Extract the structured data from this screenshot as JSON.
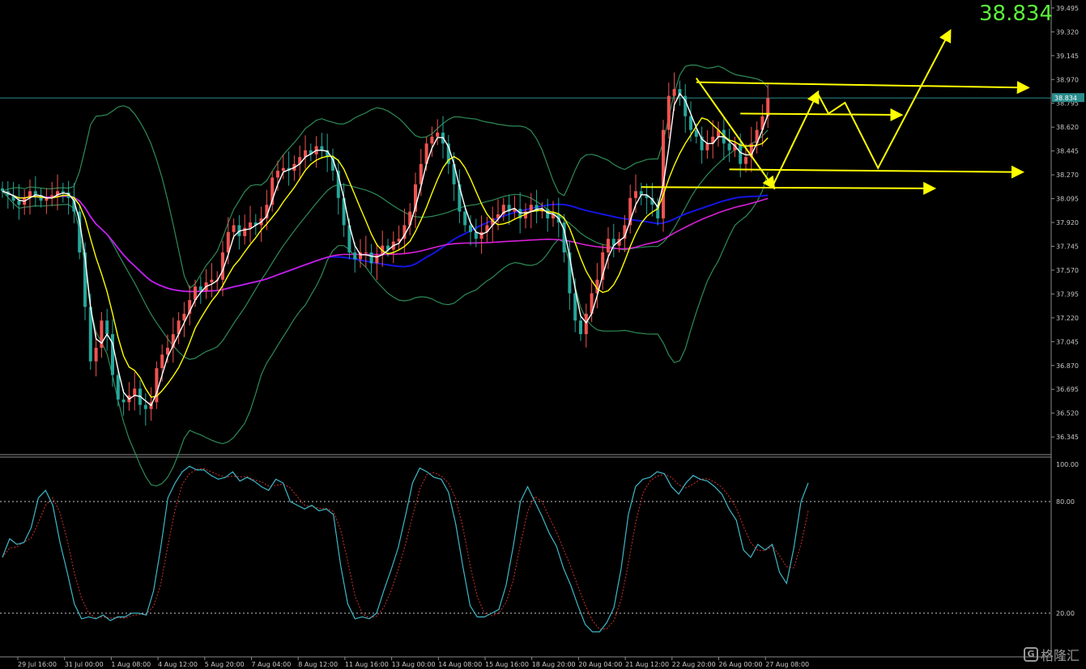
{
  "current_price_label": "38.834",
  "watermark": {
    "brand": "格隆汇",
    "logo_glyph": "G"
  },
  "colors": {
    "background": "#000000",
    "grid": "#8a8a8a",
    "bull": "#ef5350",
    "bear": "#26a69a",
    "fast_ma": "#ffffff",
    "slow_ma": "#ffff00",
    "blue_ma": "#1414e6",
    "magenta_ma": "#d81fd8",
    "bollinger": "#2e8b57",
    "price_line": "#2a8c8c",
    "arrows": "#ffff00",
    "stoch_main": "#3fb8c8",
    "stoch_signal": "#d03030",
    "price_label": "#5cf03c",
    "axis_text": "#c8c8c8"
  },
  "chart_data": [
    {
      "type": "candlestick",
      "title": "",
      "symbol_price": 38.834,
      "y_axis_ticks": [
        "39.495",
        "39.320",
        "39.145",
        "38.970",
        "38.795",
        "38.620",
        "38.445",
        "38.270",
        "38.095",
        "37.920",
        "37.745",
        "37.570",
        "37.395",
        "37.220",
        "37.045",
        "36.870",
        "36.695",
        "36.520",
        "36.345"
      ],
      "ylim": [
        36.245,
        39.53
      ],
      "x_axis_ticks": [
        "29 Jul 16:00",
        "31 Jul 00:00",
        "1 Aug 08:00",
        "4 Aug 12:00",
        "5 Aug 20:00",
        "7 Aug 04:00",
        "8 Aug 12:00",
        "11 Aug 16:00",
        "13 Aug 00:00",
        "14 Aug 08:00",
        "15 Aug 16:00",
        "18 Aug 20:00",
        "20 Aug 04:00",
        "21 Aug 12:00",
        "22 Aug 20:00",
        "26 Aug 00:00",
        "27 Aug 08:00"
      ],
      "price_line": 38.834,
      "closes": [
        38.15,
        38.12,
        38.08,
        38.05,
        38.1,
        38.15,
        38.12,
        38.08,
        38.1,
        38.12,
        38.15,
        38.14,
        38.1,
        38.0,
        37.7,
        37.3,
        36.9,
        37.0,
        37.2,
        37.1,
        36.8,
        36.62,
        36.6,
        36.65,
        36.7,
        36.58,
        36.55,
        36.6,
        36.85,
        36.95,
        37.0,
        37.1,
        37.2,
        37.25,
        37.35,
        37.45,
        37.42,
        37.48,
        37.5,
        37.5,
        37.7,
        37.85,
        37.9,
        37.82,
        37.88,
        37.92,
        37.9,
        37.95,
        38.05,
        38.25,
        38.3,
        38.32,
        38.3,
        38.35,
        38.4,
        38.45,
        38.42,
        38.48,
        38.45,
        38.4,
        38.3,
        38.1,
        37.9,
        37.7,
        37.65,
        37.7,
        37.7,
        37.62,
        37.68,
        37.75,
        37.72,
        37.78,
        37.8,
        37.9,
        38.0,
        38.2,
        38.35,
        38.5,
        38.55,
        38.58,
        38.5,
        38.35,
        38.2,
        38.0,
        37.9,
        37.85,
        37.8,
        37.85,
        37.9,
        37.95,
        37.98,
        38.05,
        38.0,
        38.02,
        37.95,
        38.0,
        38.05,
        38.0,
        38.02,
        37.95,
        37.98,
        37.92,
        37.7,
        37.4,
        37.2,
        37.1,
        37.25,
        37.4,
        37.5,
        37.7,
        37.8,
        37.75,
        37.8,
        37.9,
        38.1,
        38.15,
        38.12,
        38.1,
        38.05,
        37.95,
        38.6,
        38.85,
        38.9,
        38.85,
        38.7,
        38.6,
        38.55,
        38.45,
        38.5,
        38.55,
        38.6,
        38.5,
        38.45,
        38.5,
        38.35,
        38.4,
        38.5,
        38.6,
        38.7,
        38.834
      ],
      "series": [
        {
          "name": "",
          "role": "fast_ma",
          "period_note": ""
        },
        {
          "name": "",
          "role": "slow_ma"
        },
        {
          "name": "",
          "role": "blue_ma"
        },
        {
          "name": "",
          "role": "magenta_ma"
        },
        {
          "name": "",
          "role": "bollinger"
        }
      ],
      "annotations": {
        "horizontal_lines": [
          {
            "from_index": 126,
            "y_from": 38.95,
            "y_to": 38.91,
            "to_index": 186,
            "arrow": true
          },
          {
            "from_index": 134,
            "y_from": 38.72,
            "y_to": 38.71,
            "to_index": 163,
            "arrow": true
          },
          {
            "from_index": 132,
            "y_from": 38.31,
            "y_to": 38.29,
            "to_index": 185,
            "arrow": true
          },
          {
            "from_index": 116,
            "y_from": 38.18,
            "y_to": 38.17,
            "to_index": 169,
            "arrow": true
          }
        ],
        "polylines": [
          {
            "points": [
              [
                126,
                38.98
              ],
              [
                140,
                38.18
              ]
            ],
            "arrow": true
          },
          {
            "points": [
              [
                140,
                38.2
              ],
              [
                148,
                38.87
              ]
            ],
            "arrow": true
          },
          {
            "points": [
              [
                148,
                38.87
              ],
              [
                150,
                38.72
              ],
              [
                153,
                38.8
              ],
              [
                159,
                38.32
              ],
              [
                172,
                39.32
              ]
            ],
            "arrow": true
          }
        ]
      }
    },
    {
      "type": "line",
      "title": "",
      "y_axis_ticks": [
        "100.00",
        "80.00",
        "20.00"
      ],
      "ylim": [
        0,
        100
      ],
      "levels": [
        80,
        20
      ],
      "series": [
        {
          "name": "",
          "role": "stoch_main",
          "values": [
            50,
            60,
            57,
            58,
            66,
            82,
            86,
            78,
            58,
            42,
            25,
            17,
            18,
            17,
            19,
            16,
            18,
            18,
            20,
            20,
            19,
            32,
            55,
            82,
            90,
            96,
            99,
            97,
            97,
            94,
            92,
            93,
            96,
            91,
            93,
            91,
            88,
            86,
            92,
            90,
            80,
            78,
            76,
            78,
            75,
            76,
            73,
            46,
            25,
            17,
            18,
            17,
            20,
            32,
            43,
            55,
            72,
            90,
            98,
            96,
            93,
            92,
            85,
            68,
            45,
            24,
            18,
            18,
            20,
            22,
            35,
            56,
            80,
            88,
            80,
            72,
            63,
            56,
            44,
            35,
            24,
            14,
            10,
            10,
            15,
            23,
            44,
            73,
            88,
            92,
            93,
            96,
            95,
            88,
            84,
            90,
            94,
            92,
            91,
            88,
            84,
            76,
            70,
            54,
            50,
            57,
            54,
            57,
            42,
            36,
            55,
            80,
            90
          ]
        }
      ]
    }
  ]
}
